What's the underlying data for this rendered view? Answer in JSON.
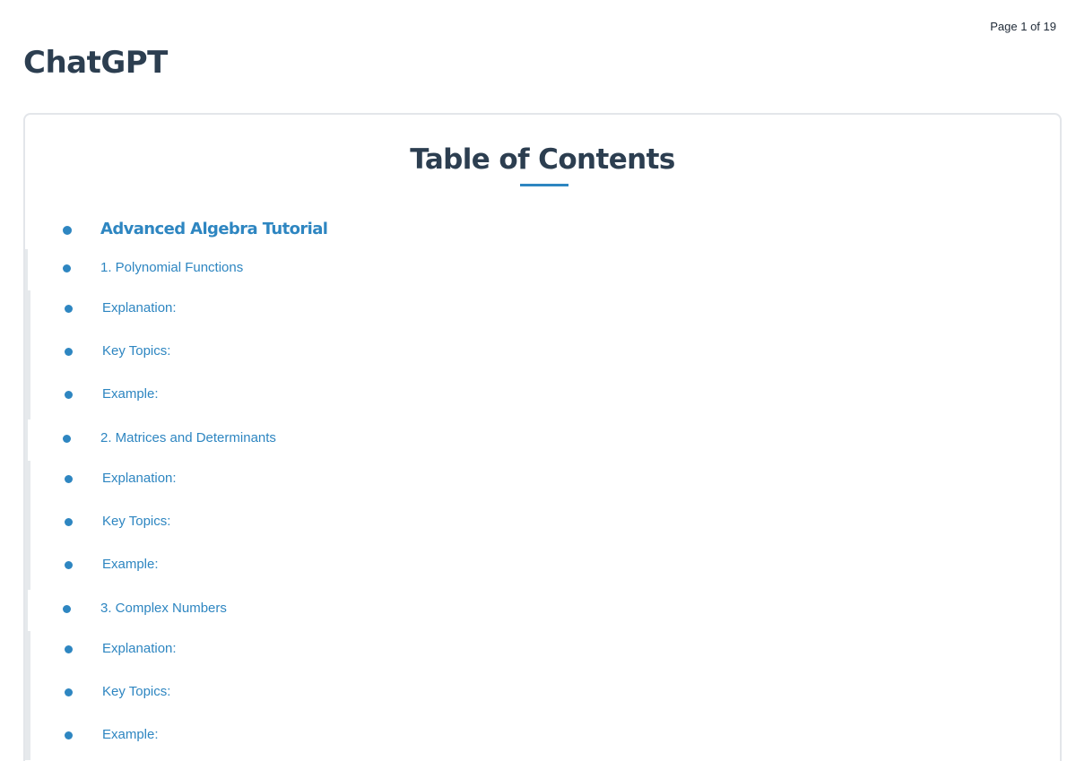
{
  "header": {
    "page_counter": "Page 1 of 19",
    "app_title": "ChatGPT"
  },
  "toc": {
    "heading": "Table of Contents",
    "root": {
      "label": "Advanced Algebra Tutorial",
      "sections": [
        {
          "label": "1. Polynomial Functions",
          "children": [
            "Explanation:",
            "Key Topics:",
            "Example:"
          ]
        },
        {
          "label": "2. Matrices and Determinants",
          "children": [
            "Explanation:",
            "Key Topics:",
            "Example:"
          ]
        },
        {
          "label": "3. Complex Numbers",
          "children": [
            "Explanation:",
            "Key Topics:",
            "Example:"
          ]
        }
      ]
    }
  },
  "colors": {
    "accent": "#2e86c1",
    "heading": "#2c3e50",
    "rule": "#e6e9ec"
  }
}
